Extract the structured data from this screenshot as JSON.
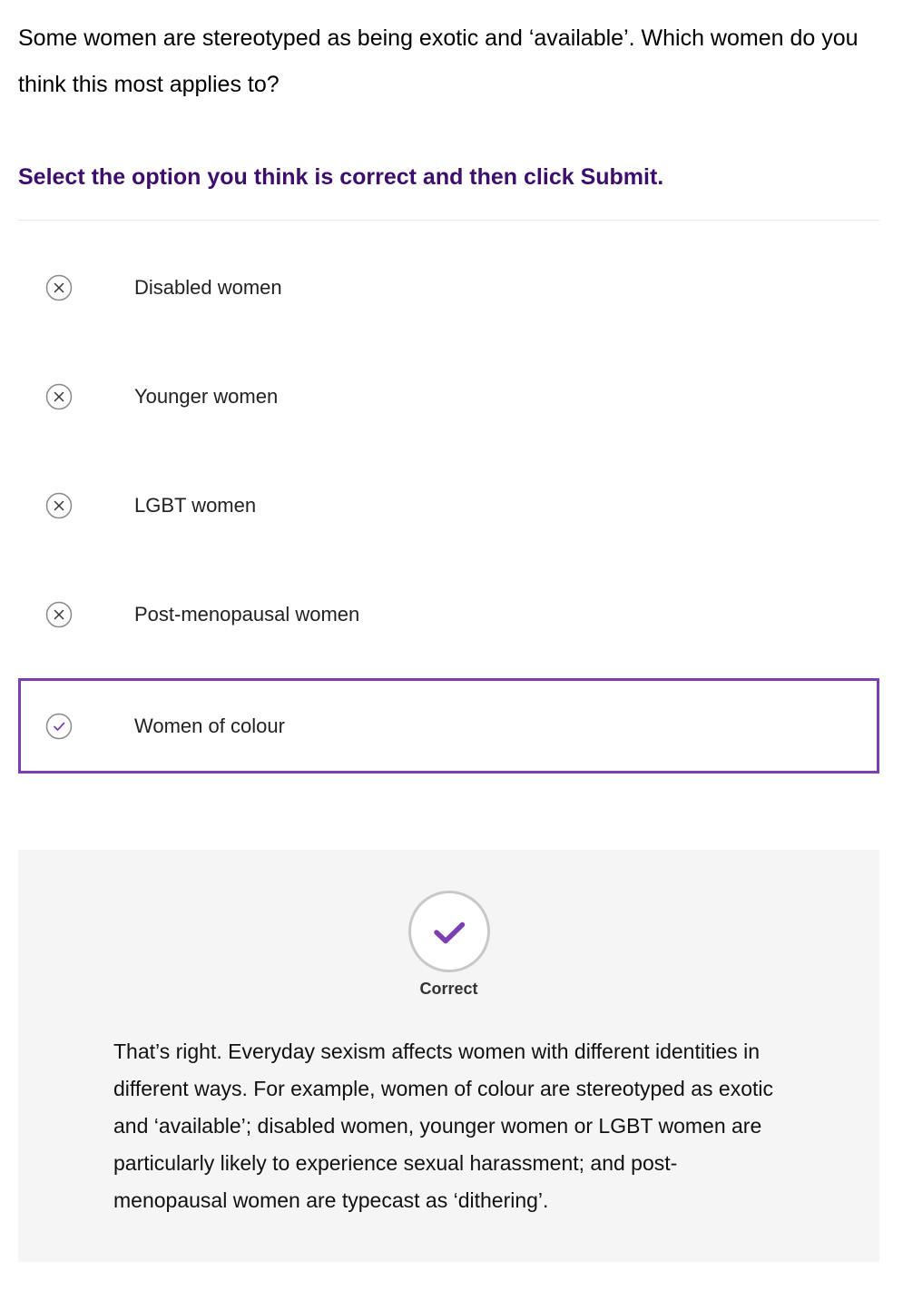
{
  "question": {
    "text": "Some women are stereotyped as being exotic and ‘available’. Which women do you think this most applies to?"
  },
  "instruction": "Select the option you think is correct and then click Submit.",
  "options": [
    {
      "label": "Disabled women",
      "status": "incorrect",
      "icon": "cross-circle-icon"
    },
    {
      "label": "Younger women",
      "status": "incorrect",
      "icon": "cross-circle-icon"
    },
    {
      "label": "LGBT women",
      "status": "incorrect",
      "icon": "cross-circle-icon"
    },
    {
      "label": "Post-menopausal women",
      "status": "incorrect",
      "icon": "cross-circle-icon"
    },
    {
      "label": "Women of colour",
      "status": "correct",
      "selected": true,
      "icon": "check-circle-icon"
    }
  ],
  "feedback": {
    "icon": "check-circle-icon",
    "status": "Correct",
    "text": "That’s right. Everyday sexism affects women with different identities in different ways. For example, women of colour are stereotyped as exotic and ‘available’; disabled women, younger women or LGBT women are particularly likely to experience sexual harassment; and post-menopausal women are typecast as ‘dithering’."
  },
  "colors": {
    "accent": "#7b3fb2",
    "instruction": "#3d0e6b",
    "feedback_bg": "#f5f5f5",
    "divider": "#e8e8e8"
  }
}
